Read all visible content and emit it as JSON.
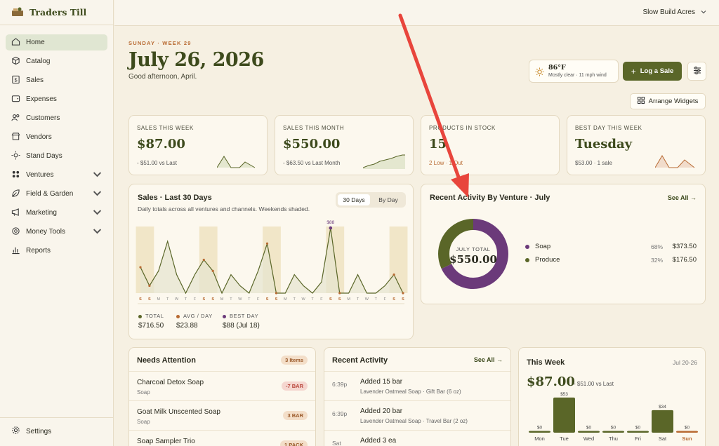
{
  "app": {
    "name": "Traders Till",
    "workspace": "Slow Build Acres"
  },
  "sidebar": {
    "items": [
      {
        "label": "Home",
        "icon": "home-icon"
      },
      {
        "label": "Catalog",
        "icon": "box-icon"
      },
      {
        "label": "Sales",
        "icon": "dollar-icon"
      },
      {
        "label": "Expenses",
        "icon": "wallet-icon"
      },
      {
        "label": "Customers",
        "icon": "users-icon"
      },
      {
        "label": "Vendors",
        "icon": "store-icon"
      },
      {
        "label": "Stand Days",
        "icon": "sun-icon"
      },
      {
        "label": "Ventures",
        "icon": "grid-icon"
      },
      {
        "label": "Field & Garden",
        "icon": "leaf-icon"
      },
      {
        "label": "Marketing",
        "icon": "megaphone-icon"
      },
      {
        "label": "Money Tools",
        "icon": "coins-icon"
      },
      {
        "label": "Reports",
        "icon": "chart-icon"
      }
    ],
    "settings": "Settings"
  },
  "header": {
    "day_label": "SUNDAY · WEEK 29",
    "date": "July 26, 2026",
    "greeting": "Good afternoon, April.",
    "weather_temp": "86°F",
    "weather_desc": "Mostly clear · 11 mph wind",
    "log_sale": "Log a Sale",
    "arrange": "Arrange Widgets"
  },
  "stats": [
    {
      "label": "SALES THIS WEEK",
      "value": "$87.00",
      "sub": "- $51.00 vs Last"
    },
    {
      "label": "SALES THIS MONTH",
      "value": "$550.00",
      "sub": "- $63.50 vs Last Month"
    },
    {
      "label": "PRODUCTS IN STOCK",
      "value": "15",
      "sub": "2 Low · 1 Out"
    },
    {
      "label": "BEST DAY THIS WEEK",
      "value": "Tuesday",
      "sub": "$53.00 · 1 sale"
    }
  ],
  "sales_chart": {
    "title": "Sales · Last 30 Days",
    "subtitle": "Daily totals across all ventures and channels. Weekends shaded.",
    "toggle": [
      "30 Days",
      "By Day"
    ],
    "peak_label": "$88",
    "legend": [
      {
        "label": "TOTAL",
        "value": "$716.50",
        "color": "#5a6628"
      },
      {
        "label": "AVG / DAY",
        "value": "$23.88",
        "color": "#b86a32"
      },
      {
        "label": "BEST DAY",
        "value": "$88 (Jul 18)",
        "color": "#6b3a7a"
      }
    ]
  },
  "chart_data": [
    {
      "type": "line",
      "title": "Sales · Last 30 Days",
      "x": [
        "S",
        "S",
        "M",
        "T",
        "W",
        "T",
        "F",
        "S",
        "S",
        "M",
        "T",
        "W",
        "T",
        "F",
        "S",
        "S",
        "M",
        "T",
        "W",
        "T",
        "F",
        "S",
        "S",
        "M",
        "T",
        "W",
        "T",
        "F",
        "S",
        "S"
      ],
      "values": [
        35,
        10,
        30,
        70,
        25,
        0,
        25,
        45,
        30,
        0,
        25,
        10,
        0,
        30,
        67,
        0,
        0,
        25,
        10,
        0,
        15,
        88,
        0,
        0,
        25,
        0,
        0,
        10,
        25,
        0
      ],
      "weekend_indices": [
        0,
        1,
        7,
        8,
        14,
        15,
        21,
        22,
        28,
        29
      ],
      "ylim": [
        0,
        90
      ],
      "grid": false
    },
    {
      "type": "pie",
      "title": "Recent Activity By Venture · July",
      "center_label": "JULY TOTAL",
      "center_value": "$550.00",
      "series": [
        {
          "name": "Soap",
          "pct": "68%",
          "amount": "$373.50",
          "value": 373.5,
          "color": "#6b3a7a"
        },
        {
          "name": "Produce",
          "pct": "32%",
          "amount": "$176.50",
          "value": 176.5,
          "color": "#5a6628"
        }
      ]
    },
    {
      "type": "bar",
      "title": "This Week",
      "categories": [
        "Mon",
        "Tue",
        "Wed",
        "Thu",
        "Fri",
        "Sat",
        "Sun"
      ],
      "values": [
        0,
        53,
        0,
        0,
        0,
        34,
        0
      ],
      "value_labels": [
        "$0",
        "$53",
        "$0",
        "$0",
        "$0",
        "$34",
        "$0"
      ],
      "ylim": [
        0,
        55
      ]
    }
  ],
  "venture_card": {
    "title": "Recent Activity By Venture · July",
    "see_all": "See All →"
  },
  "needs_attention": {
    "title": "Needs Attention",
    "badge": "3 Items",
    "items": [
      {
        "name": "Charcoal Detox Soap",
        "sub": "Soap",
        "badge": "-7 BAR"
      },
      {
        "name": "Goat Milk Unscented Soap",
        "sub": "Soap",
        "badge": "3 BAR"
      },
      {
        "name": "Soap Sampler Trio",
        "sub": "",
        "badge": "1 PACK"
      }
    ]
  },
  "recent_activity": {
    "title": "Recent Activity",
    "see_all": "See All →",
    "items": [
      {
        "time": "6:39p",
        "title": "Added 15 bar",
        "sub": "Lavender Oatmeal Soap · Gift Bar (6 oz)"
      },
      {
        "time": "6:39p",
        "title": "Added 20 bar",
        "sub": "Lavender Oatmeal Soap · Travel Bar (2 oz)"
      },
      {
        "time": "Sat",
        "title": "Added 3 ea",
        "sub": ""
      }
    ]
  },
  "this_week": {
    "title": "This Week",
    "range": "Jul 20-26",
    "value": "$87.00",
    "sub": "- $51.00 vs Last"
  }
}
